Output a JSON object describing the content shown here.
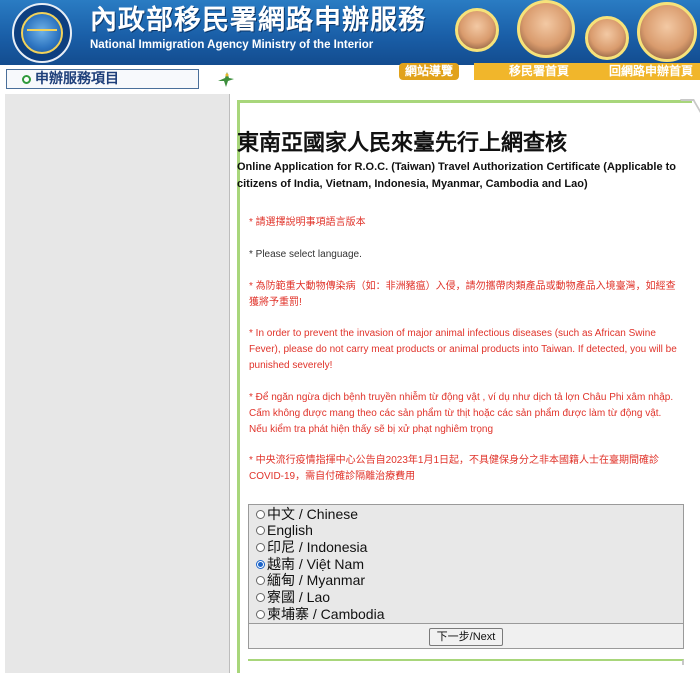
{
  "header": {
    "agency_zh": "內政部移民署網路申辦服務",
    "agency_en": "National Immigration Agency Ministry of the Interior",
    "links": {
      "sitemap": "網站導覽",
      "agency_home": "移民署首頁",
      "back_home": "回網路申辦首頁"
    },
    "service_items_label": "申辦服務項目"
  },
  "main": {
    "title": "東南亞國家人民來臺先行上網查核",
    "subtitle": "Online Application for R.O.C. (Taiwan) Travel Authorization Certificate (Applicable to citizens of India, Vietnam, Indonesia, Myanmar, Cambodia and Lao)",
    "notes": {
      "select_language_zh": "* 請選擇說明事項語言版本",
      "select_language_en": "* Please select language.",
      "disease_zh": "* 為防範重大動物傳染病（如：非洲豬瘟）入侵，請勿攜帶肉類產品或動物產品入境臺灣，如經查獲將予重罰!",
      "disease_en": "* In order to prevent the invasion of major animal infectious diseases (such as African Swine Fever), please do not carry meat products or animal products into Taiwan. If detected, you will be punished severely!",
      "disease_vi": "* Để ngăn ngừa dịch bệnh truyền nhiễm từ động vật , ví dụ như dịch tả lợn Châu Phi xâm nhập. Cấm không được mang theo các sản phẩm từ thịt hoặc các sản phẩm được làm từ động vật. Nếu kiểm tra phát hiện thấy sẽ bị xử phạt nghiêm trọng",
      "covid_zh": "* 中央流行疫情指揮中心公告自2023年1月1日起，不具健保身分之非本國籍人士在臺期間確診COVID-19，需自付確診隔離治療費用"
    },
    "languages": [
      {
        "label": "中文 / Chinese",
        "checked": false
      },
      {
        "label": "English",
        "checked": false
      },
      {
        "label": "印尼 / Indonesia",
        "checked": false
      },
      {
        "label": "越南 / Việt Nam",
        "checked": true
      },
      {
        "label": "緬甸 / Myanmar",
        "checked": false
      },
      {
        "label": "寮國 / Lao",
        "checked": false
      },
      {
        "label": "柬埔寨 / Cambodia",
        "checked": false
      }
    ],
    "next_label": "下一步/Next"
  },
  "colors": {
    "banner_blue": "#1a5fa8",
    "link_gold": "#f1b62b",
    "content_green": "#a8d67b",
    "notice_red": "#e0332a"
  }
}
